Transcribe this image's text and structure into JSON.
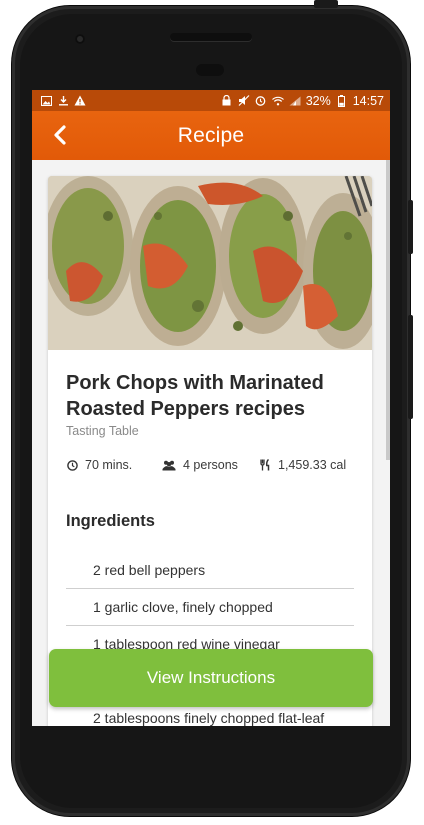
{
  "status_bar": {
    "battery_percent": "32%",
    "time": "14:57"
  },
  "app_bar": {
    "title": "Recipe"
  },
  "recipe": {
    "title": "Pork Chops with Marinated Roasted Peppers recipes",
    "source": "Tasting Table",
    "time": "70 mins.",
    "servings": "4 persons",
    "calories": "1,459.33 cal"
  },
  "ingredients_section": {
    "heading": "Ingredients",
    "items": [
      "2 red bell peppers",
      "1 garlic clove, finely chopped",
      "1 tablespoon red wine vinegar",
      "",
      "2 tablespoons finely chopped flat-leaf"
    ]
  },
  "cta": {
    "label": "View Instructions"
  },
  "colors": {
    "status_bar": "#b84a08",
    "app_bar": "#e25a08",
    "cta": "#7fbf3d",
    "screen_bg": "#f3f3f3"
  }
}
